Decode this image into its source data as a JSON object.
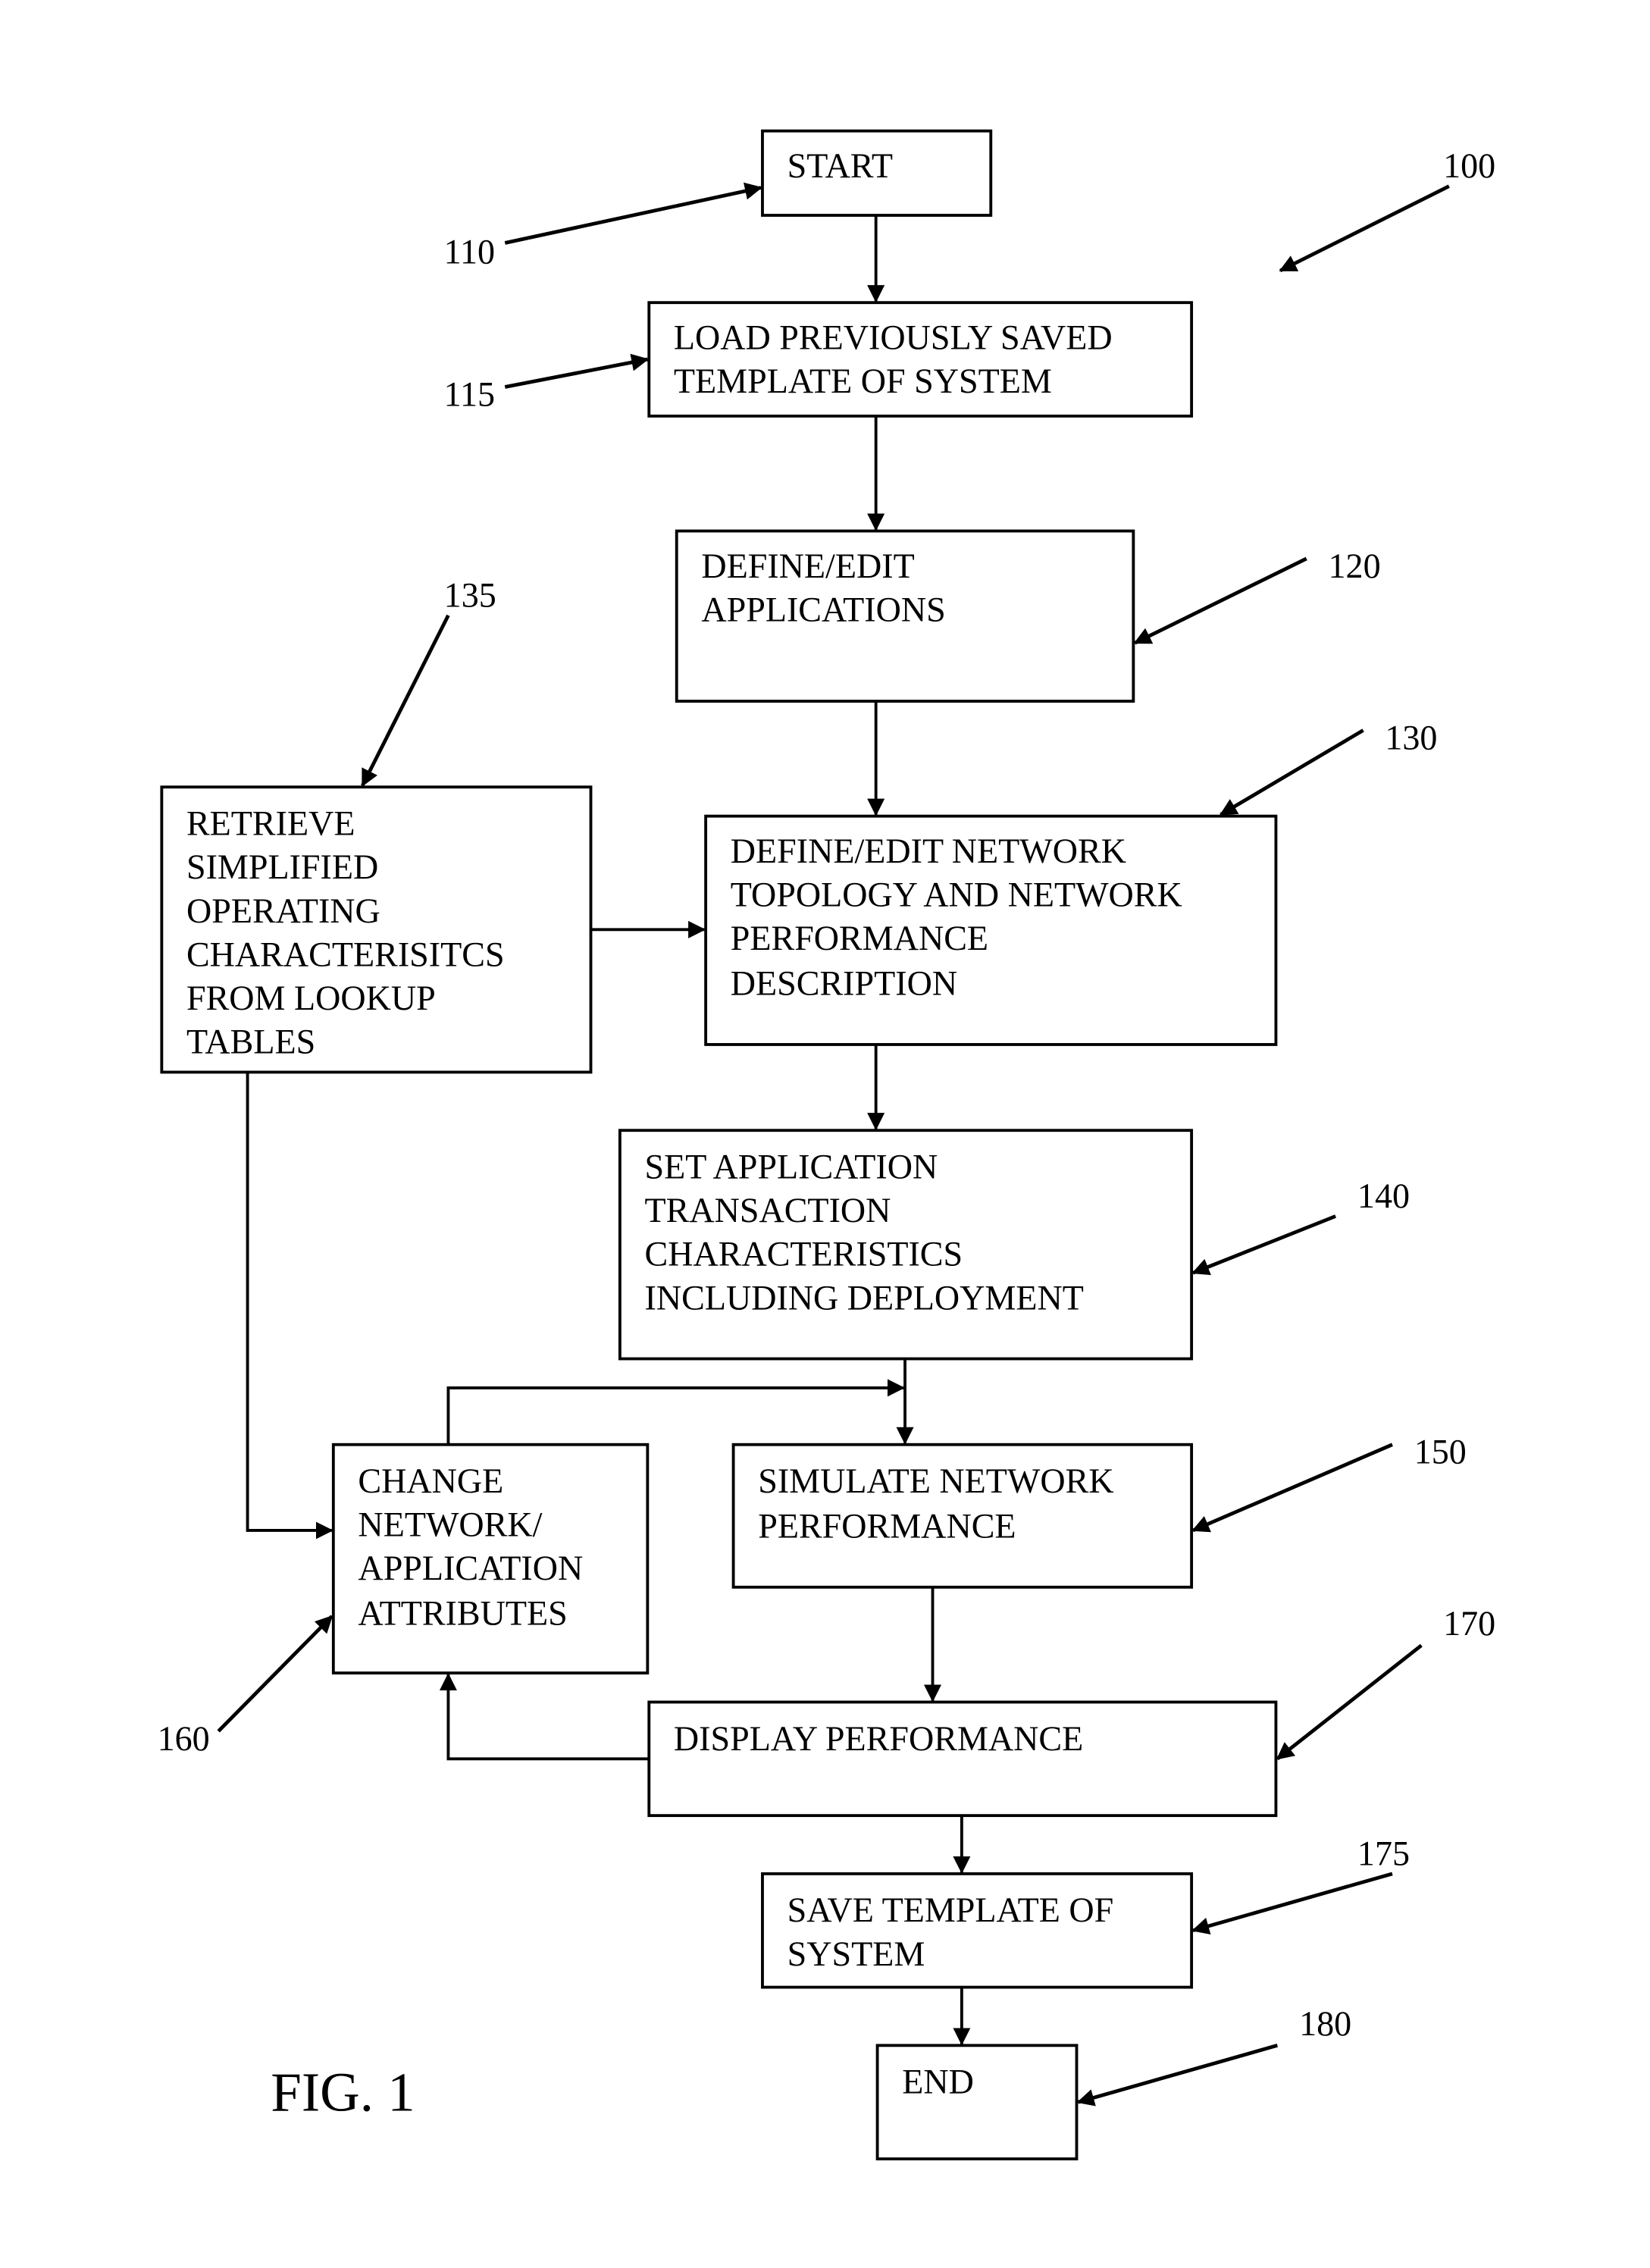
{
  "figure_label": "FIG. 1",
  "diagram_ref": "100",
  "steps": {
    "start": {
      "ref": "110",
      "lines": [
        "START"
      ]
    },
    "load": {
      "ref": "115",
      "lines": [
        "LOAD PREVIOUSLY SAVED",
        "TEMPLATE OF SYSTEM"
      ]
    },
    "define_apps": {
      "ref": "120",
      "lines": [
        "DEFINE/EDIT",
        "APPLICATIONS"
      ]
    },
    "define_network": {
      "ref": "130",
      "lines": [
        "DEFINE/EDIT NETWORK",
        "TOPOLOGY AND NETWORK",
        "PERFORMANCE",
        "DESCRIPTION"
      ]
    },
    "retrieve": {
      "ref": "135",
      "lines": [
        "RETRIEVE",
        "SIMPLIFIED",
        "OPERATING",
        "CHARACTERISITCS",
        "FROM LOOKUP",
        "TABLES"
      ]
    },
    "set_transaction": {
      "ref": "140",
      "lines": [
        "SET APPLICATION",
        "TRANSACTION",
        "CHARACTERISTICS",
        "INCLUDING DEPLOYMENT"
      ]
    },
    "simulate": {
      "ref": "150",
      "lines": [
        "SIMULATE NETWORK",
        "PERFORMANCE"
      ]
    },
    "change": {
      "ref": "160",
      "lines": [
        "CHANGE",
        "NETWORK/",
        "APPLICATION",
        "ATTRIBUTES"
      ]
    },
    "display": {
      "ref": "170",
      "lines": [
        "DISPLAY PERFORMANCE"
      ]
    },
    "save": {
      "ref": "175",
      "lines": [
        "SAVE TEMPLATE OF",
        "SYSTEM"
      ]
    },
    "end": {
      "ref": "180",
      "lines": [
        "END"
      ]
    }
  }
}
